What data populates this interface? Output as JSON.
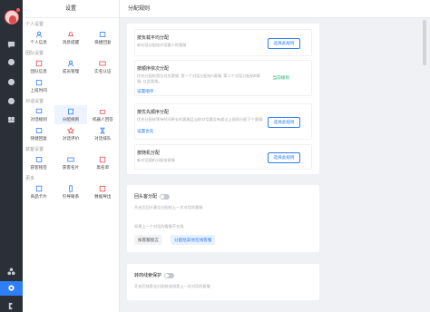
{
  "settings": {
    "title": "设置",
    "sections": [
      {
        "title": "个人设置",
        "items": [
          "个人信息",
          "消息提醒",
          "快捷回复"
        ]
      },
      {
        "title": "团队设置",
        "items": [
          "团队信息",
          "成员管理",
          "实名认证",
          "上班时间"
        ]
      },
      {
        "title": "对话设置",
        "items": [
          "对话规则",
          "分配规则",
          "机器人回答",
          "快捷回复",
          "对话评价",
          "对话排队"
        ]
      },
      {
        "title": "获客设置",
        "items": [
          "获客铭签",
          "获客名片",
          "黑名单"
        ]
      },
      {
        "title": "更多",
        "items": [
          "商品卡片",
          "引导联系",
          "数据导出"
        ]
      }
    ]
  },
  "main": {
    "title": "分配规则",
    "options": [
      {
        "title": "按负载平均分配",
        "desc": "新对话分配给对话量少的客服",
        "button": "选择此规则"
      },
      {
        "title": "按顺序依次分配",
        "desc": "优先分配给首位对应客服, 第一个对话分配给A客服, 第二个对话分配给B客服, 以此类推。",
        "link": "设置顺序",
        "selected": "当前规则"
      },
      {
        "title": "按优先顺序分配",
        "desc": "优先分配给等待时间更长的客服且当前对话量没有超过上限再分配下个客服",
        "link": "设置优先",
        "button": "选择此规则"
      },
      {
        "title": "按随机分配",
        "desc": "新对话随机分配给客服",
        "button": "选择此规则"
      }
    ],
    "history": {
      "title": "回头客分配",
      "desc": "开启后回头客会分配给上一次对话的客服",
      "desc2": "如果上一个对话的客服不在线",
      "chips": [
        "按客服留言",
        "分配给其他在线客服"
      ]
    },
    "protect": {
      "title": "转商线索保护",
      "desc": "开启后线索会分配给该线索上一次对话的客服"
    }
  },
  "rail": {
    "icons": [
      "chat-icon",
      "message-icon",
      "clock-icon",
      "compass-icon",
      "team-icon",
      "apps-icon",
      "gear-icon",
      "exit-icon"
    ]
  },
  "colors": {
    "accent": "#2d7ef7",
    "rail": "#2b3038",
    "selected": "#19b36b"
  }
}
